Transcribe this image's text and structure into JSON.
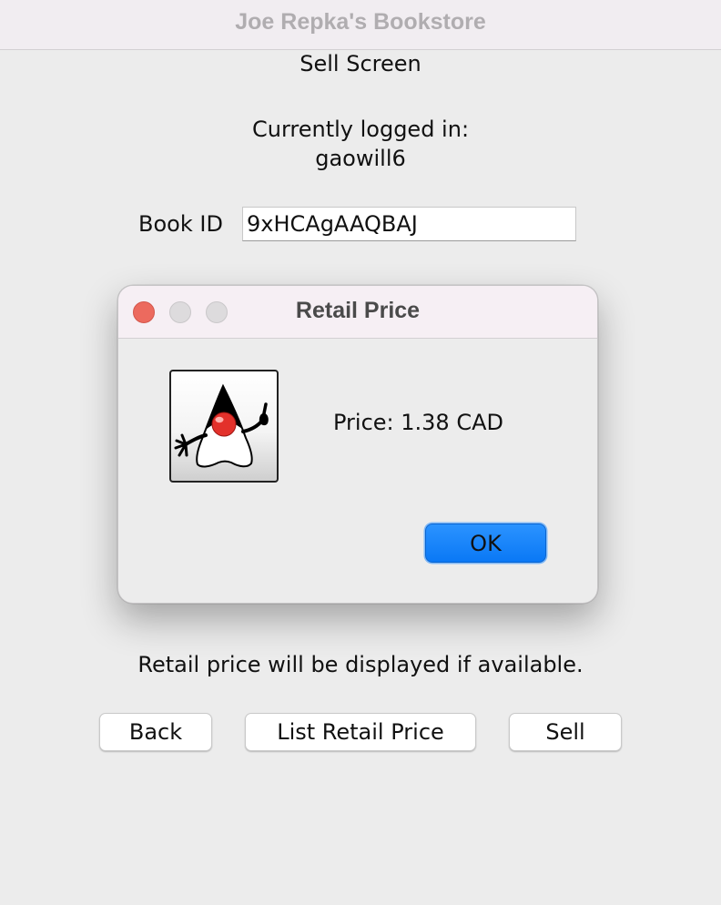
{
  "window": {
    "title": "Joe Repka's Bookstore"
  },
  "main": {
    "screen_title": "Sell Screen",
    "logged_in_label": "Currently logged in:",
    "username": "gaowill6",
    "book_id_label": "Book ID",
    "book_id_value": "9xHCAgAAQBAJ",
    "info_text": "Retail price will be displayed if available.",
    "buttons": {
      "back": "Back",
      "list_retail_price": "List Retail Price",
      "sell": "Sell"
    }
  },
  "dialog": {
    "title": "Retail Price",
    "message": "Price: 1.38 CAD",
    "ok_label": "OK",
    "icon": "java-duke-icon",
    "traffic_lights": {
      "close_color": "#ec6a5e",
      "inactive_color": "#dddbdd"
    }
  },
  "colors": {
    "accent": "#0a78f5",
    "window_background": "#ececec"
  }
}
